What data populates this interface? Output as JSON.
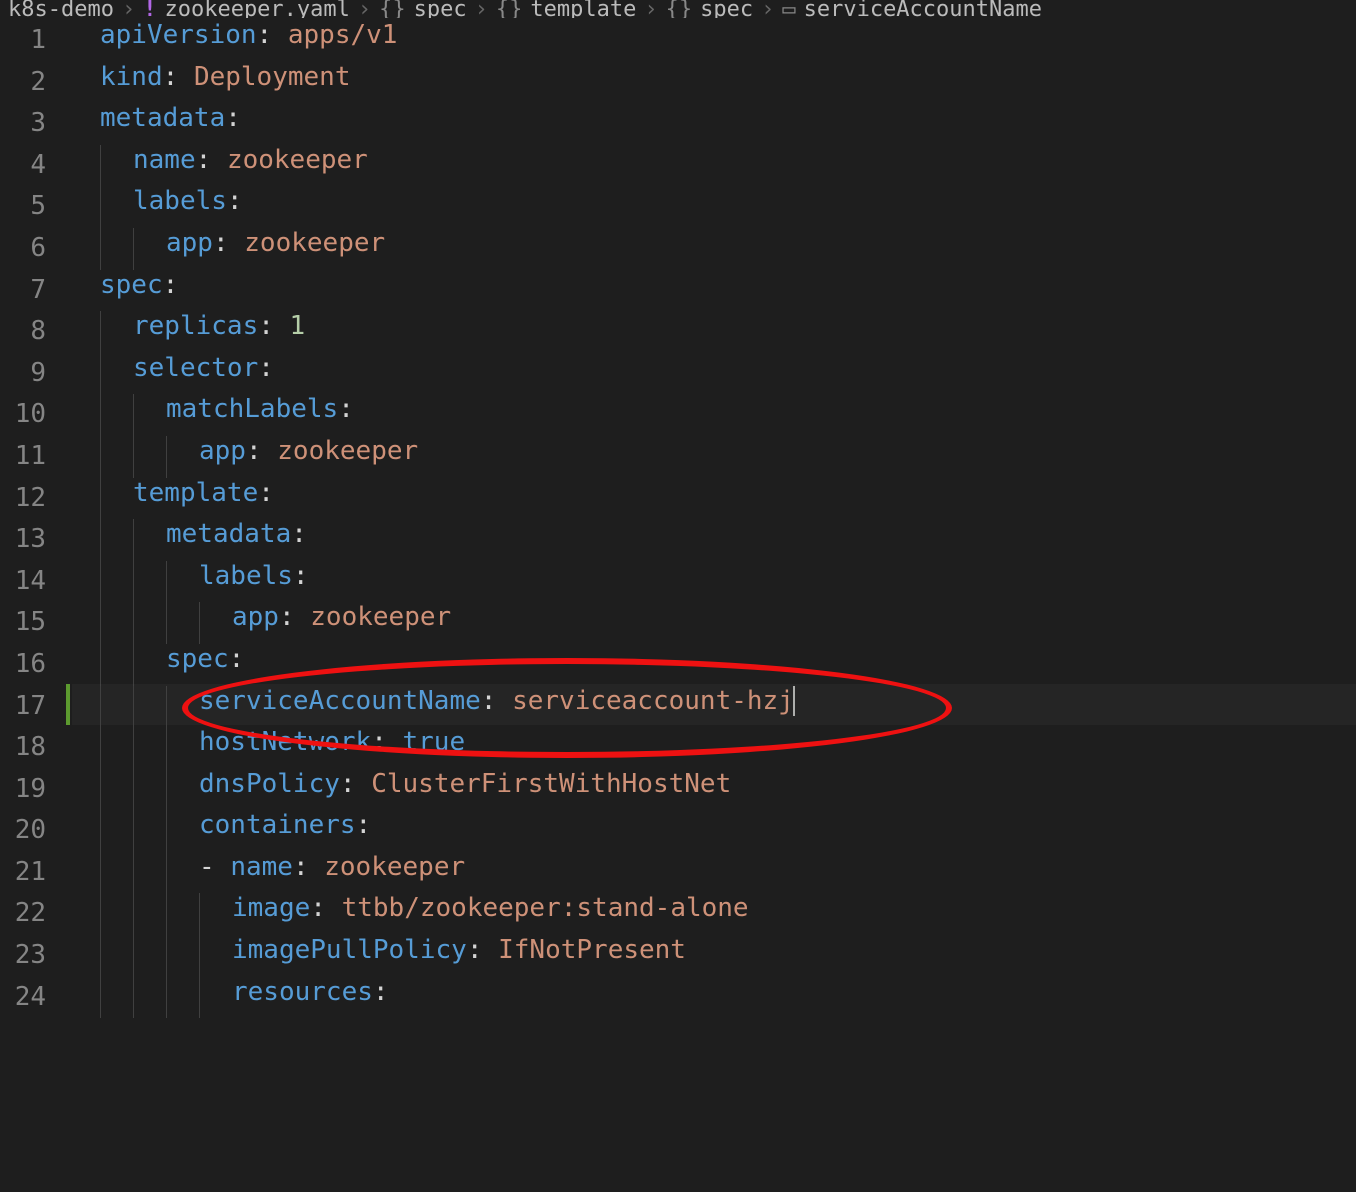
{
  "breadcrumb": {
    "items": [
      {
        "icon": "",
        "text": "k8s-demo"
      },
      {
        "icon": "!",
        "text": "zookeeper.yaml"
      },
      {
        "icon": "{}",
        "text": "spec"
      },
      {
        "icon": "{}",
        "text": "template"
      },
      {
        "icon": "{}",
        "text": "spec"
      },
      {
        "icon": "▭",
        "text": "serviceAccountName"
      }
    ]
  },
  "cursorLine": 17,
  "highlightedLine": 17,
  "modifiedLine": 17,
  "annotation": {
    "type": "ellipse",
    "targetLine": 17
  },
  "lines": [
    {
      "n": 1,
      "indent": 0,
      "tokens": [
        [
          "key",
          "apiVersion"
        ],
        [
          "punct",
          ": "
        ],
        [
          "str",
          "apps/v1"
        ]
      ]
    },
    {
      "n": 2,
      "indent": 0,
      "tokens": [
        [
          "key",
          "kind"
        ],
        [
          "punct",
          ": "
        ],
        [
          "str",
          "Deployment"
        ]
      ]
    },
    {
      "n": 3,
      "indent": 0,
      "tokens": [
        [
          "key",
          "metadata"
        ],
        [
          "punct",
          ":"
        ]
      ]
    },
    {
      "n": 4,
      "indent": 1,
      "tokens": [
        [
          "key",
          "name"
        ],
        [
          "punct",
          ": "
        ],
        [
          "str",
          "zookeeper"
        ]
      ]
    },
    {
      "n": 5,
      "indent": 1,
      "tokens": [
        [
          "key",
          "labels"
        ],
        [
          "punct",
          ":"
        ]
      ]
    },
    {
      "n": 6,
      "indent": 2,
      "tokens": [
        [
          "key",
          "app"
        ],
        [
          "punct",
          ": "
        ],
        [
          "str",
          "zookeeper"
        ]
      ]
    },
    {
      "n": 7,
      "indent": 0,
      "tokens": [
        [
          "key",
          "spec"
        ],
        [
          "punct",
          ":"
        ]
      ]
    },
    {
      "n": 8,
      "indent": 1,
      "tokens": [
        [
          "key",
          "replicas"
        ],
        [
          "punct",
          ": "
        ],
        [
          "num",
          "1"
        ]
      ]
    },
    {
      "n": 9,
      "indent": 1,
      "tokens": [
        [
          "key",
          "selector"
        ],
        [
          "punct",
          ":"
        ]
      ]
    },
    {
      "n": 10,
      "indent": 2,
      "tokens": [
        [
          "key",
          "matchLabels"
        ],
        [
          "punct",
          ":"
        ]
      ]
    },
    {
      "n": 11,
      "indent": 3,
      "tokens": [
        [
          "key",
          "app"
        ],
        [
          "punct",
          ": "
        ],
        [
          "str",
          "zookeeper"
        ]
      ]
    },
    {
      "n": 12,
      "indent": 1,
      "tokens": [
        [
          "key",
          "template"
        ],
        [
          "punct",
          ":"
        ]
      ]
    },
    {
      "n": 13,
      "indent": 2,
      "tokens": [
        [
          "key",
          "metadata"
        ],
        [
          "punct",
          ":"
        ]
      ]
    },
    {
      "n": 14,
      "indent": 3,
      "tokens": [
        [
          "key",
          "labels"
        ],
        [
          "punct",
          ":"
        ]
      ]
    },
    {
      "n": 15,
      "indent": 4,
      "tokens": [
        [
          "key",
          "app"
        ],
        [
          "punct",
          ": "
        ],
        [
          "str",
          "zookeeper"
        ]
      ]
    },
    {
      "n": 16,
      "indent": 2,
      "tokens": [
        [
          "key",
          "spec"
        ],
        [
          "punct",
          ":"
        ]
      ]
    },
    {
      "n": 17,
      "indent": 3,
      "tokens": [
        [
          "key",
          "serviceAccountName"
        ],
        [
          "punct",
          ": "
        ],
        [
          "str",
          "serviceaccount-hzj"
        ]
      ]
    },
    {
      "n": 18,
      "indent": 3,
      "tokens": [
        [
          "key",
          "hostNetwork"
        ],
        [
          "punct",
          ": "
        ],
        [
          "bool",
          "true"
        ]
      ]
    },
    {
      "n": 19,
      "indent": 3,
      "tokens": [
        [
          "key",
          "dnsPolicy"
        ],
        [
          "punct",
          ": "
        ],
        [
          "str",
          "ClusterFirstWithHostNet"
        ]
      ]
    },
    {
      "n": 20,
      "indent": 3,
      "tokens": [
        [
          "key",
          "containers"
        ],
        [
          "punct",
          ":"
        ]
      ]
    },
    {
      "n": 21,
      "indent": 3,
      "tokens": [
        [
          "dash",
          "- "
        ],
        [
          "key",
          "name"
        ],
        [
          "punct",
          ": "
        ],
        [
          "str",
          "zookeeper"
        ]
      ]
    },
    {
      "n": 22,
      "indent": 4,
      "tokens": [
        [
          "key",
          "image"
        ],
        [
          "punct",
          ": "
        ],
        [
          "str",
          "ttbb/zookeeper:stand-alone"
        ]
      ]
    },
    {
      "n": 23,
      "indent": 4,
      "tokens": [
        [
          "key",
          "imagePullPolicy"
        ],
        [
          "punct",
          ": "
        ],
        [
          "str",
          "IfNotPresent"
        ]
      ]
    },
    {
      "n": 24,
      "indent": 4,
      "tokens": [
        [
          "key",
          "resources"
        ],
        [
          "punct",
          ":"
        ]
      ]
    }
  ]
}
